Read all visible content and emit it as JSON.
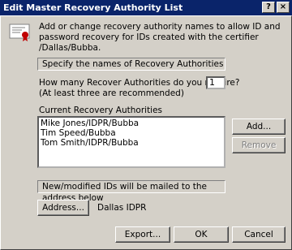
{
  "window": {
    "title": "Edit Master Recovery Authority List",
    "help_glyph": "?",
    "close_glyph": "×"
  },
  "intro": "Add or change recovery authority names to allow ID and password recovery for IDs created with the certifier /Dallas/Bubba.",
  "section1": "Specify the names of Recovery Authorities",
  "count": {
    "label": "How many Recover Authorities do you require?",
    "hint": "(At least three are recommended)",
    "value": "1"
  },
  "list": {
    "label": "Current Recovery Authorities",
    "items": [
      "Mike Jones/IDPR/Bubba",
      "Tim Speed/Bubba",
      "Tom Smith/IDPR/Bubba"
    ]
  },
  "buttons": {
    "add": "Add...",
    "remove": "Remove",
    "address": "Address...",
    "export": "Export...",
    "ok": "OK",
    "cancel": "Cancel"
  },
  "section2": "New/modified IDs will be mailed to the address below",
  "address_value": "Dallas IDPR",
  "icons": {
    "certificate": "certificate-icon"
  }
}
